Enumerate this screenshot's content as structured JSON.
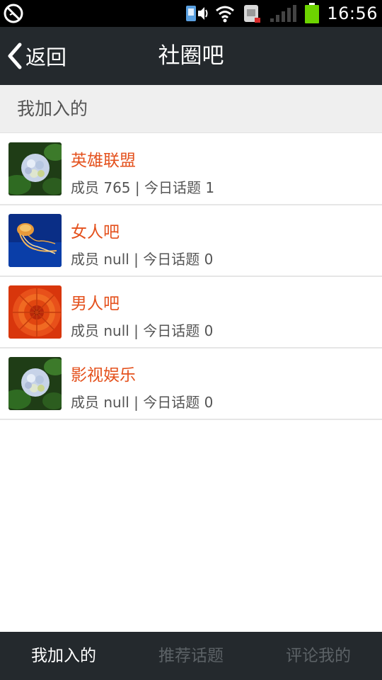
{
  "status_bar": {
    "time": "16:56",
    "icons": [
      "blocked-icon",
      "sim-volume-icon",
      "wifi-icon",
      "sim-card-icon",
      "signal-icon",
      "battery-icon"
    ]
  },
  "titlebar": {
    "back_label": "返回",
    "title": "社圈吧"
  },
  "section": {
    "label": "我加入的"
  },
  "groups": [
    {
      "name": "英雄联盟",
      "meta": "成员 765 | 今日话题 1",
      "thumb": "hydrangea"
    },
    {
      "name": "女人吧",
      "meta": "成员 null | 今日话题 0",
      "thumb": "jellyfish"
    },
    {
      "name": "男人吧",
      "meta": "成员 null | 今日话题 0",
      "thumb": "chrysanthemum"
    },
    {
      "name": "影视娱乐",
      "meta": "成员 null | 今日话题 0",
      "thumb": "hydrangea"
    }
  ],
  "tabs": [
    {
      "label": "我加入的",
      "active": true
    },
    {
      "label": "推荐话题",
      "active": false
    },
    {
      "label": "评论我的",
      "active": false
    }
  ],
  "colors": {
    "bar_background": "#24292d",
    "accent_orange": "#e4511d",
    "battery_green": "#6dd400"
  }
}
